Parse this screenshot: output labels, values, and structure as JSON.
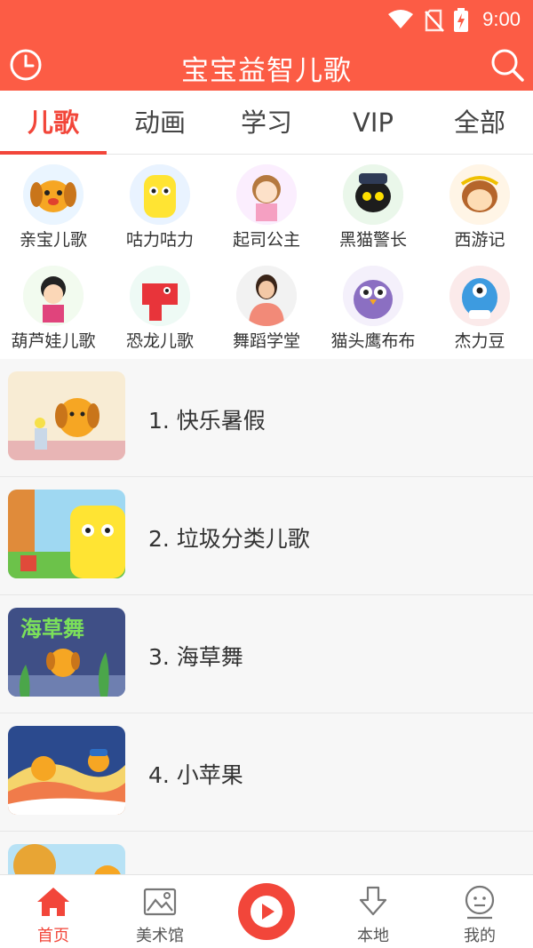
{
  "status_bar": {
    "time": "9:00"
  },
  "header": {
    "title": "宝宝益智儿歌"
  },
  "tabs": [
    {
      "label": "儿歌",
      "active": true
    },
    {
      "label": "动画",
      "active": false
    },
    {
      "label": "学习",
      "active": false
    },
    {
      "label": "VIP",
      "active": false
    },
    {
      "label": "全部",
      "active": false
    }
  ],
  "categories": [
    {
      "label": "亲宝儿歌",
      "icon": "puppy-avatar"
    },
    {
      "label": "咕力咕力",
      "icon": "yellow-monster-avatar"
    },
    {
      "label": "起司公主",
      "icon": "princess-avatar"
    },
    {
      "label": "黑猫警长",
      "icon": "black-cat-avatar"
    },
    {
      "label": "西游记",
      "icon": "monkey-avatar"
    },
    {
      "label": "葫芦娃儿歌",
      "icon": "gourd-kid-avatar"
    },
    {
      "label": "恐龙儿歌",
      "icon": "dinosaur-avatar"
    },
    {
      "label": "舞蹈学堂",
      "icon": "dancer-avatar"
    },
    {
      "label": "猫头鹰布布",
      "icon": "owl-avatar"
    },
    {
      "label": "杰力豆",
      "icon": "blue-monster-avatar"
    }
  ],
  "songs": [
    {
      "title": "1. 快乐暑假"
    },
    {
      "title": "2. 垃圾分类儿歌"
    },
    {
      "title": "3. 海草舞",
      "thumb_text": "海草舞"
    },
    {
      "title": "4. 小苹果"
    },
    {
      "title": ""
    }
  ],
  "bottom_nav": [
    {
      "label": "首页",
      "icon": "home-icon",
      "active": true
    },
    {
      "label": "美术馆",
      "icon": "gallery-icon",
      "active": false
    },
    {
      "label": "",
      "icon": "play-icon",
      "active": false
    },
    {
      "label": "本地",
      "icon": "download-icon",
      "active": false
    },
    {
      "label": "我的",
      "icon": "profile-icon",
      "active": false
    }
  ],
  "colors": {
    "brand": "#fc5c45",
    "accent": "#f2463a"
  }
}
